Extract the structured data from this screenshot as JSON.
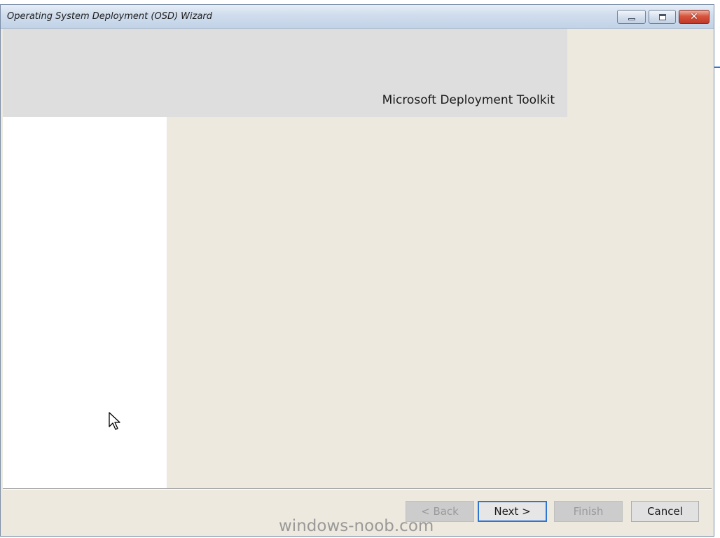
{
  "window": {
    "title": "Operating System Deployment (OSD) Wizard",
    "minimize_icon": "minimize-icon",
    "maximize_icon": "maximize-icon",
    "close_icon": "close-icon",
    "close_glyph": "✕"
  },
  "banner": {
    "product_name": "Microsoft Deployment Toolkit"
  },
  "footer": {
    "back_label": "< Back",
    "next_label": "Next >",
    "finish_label": "Finish",
    "cancel_label": "Cancel",
    "back_enabled": false,
    "next_enabled": true,
    "finish_enabled": false,
    "cancel_enabled": true
  },
  "watermark": {
    "text": "windows-noob.com"
  },
  "cursor": {
    "icon": "mouse-pointer-icon"
  },
  "colors": {
    "content_bg": "#ede9df",
    "banner_bg": "#dedede",
    "default_button_border": "#2f76d2",
    "close_button": "#c0392b"
  }
}
